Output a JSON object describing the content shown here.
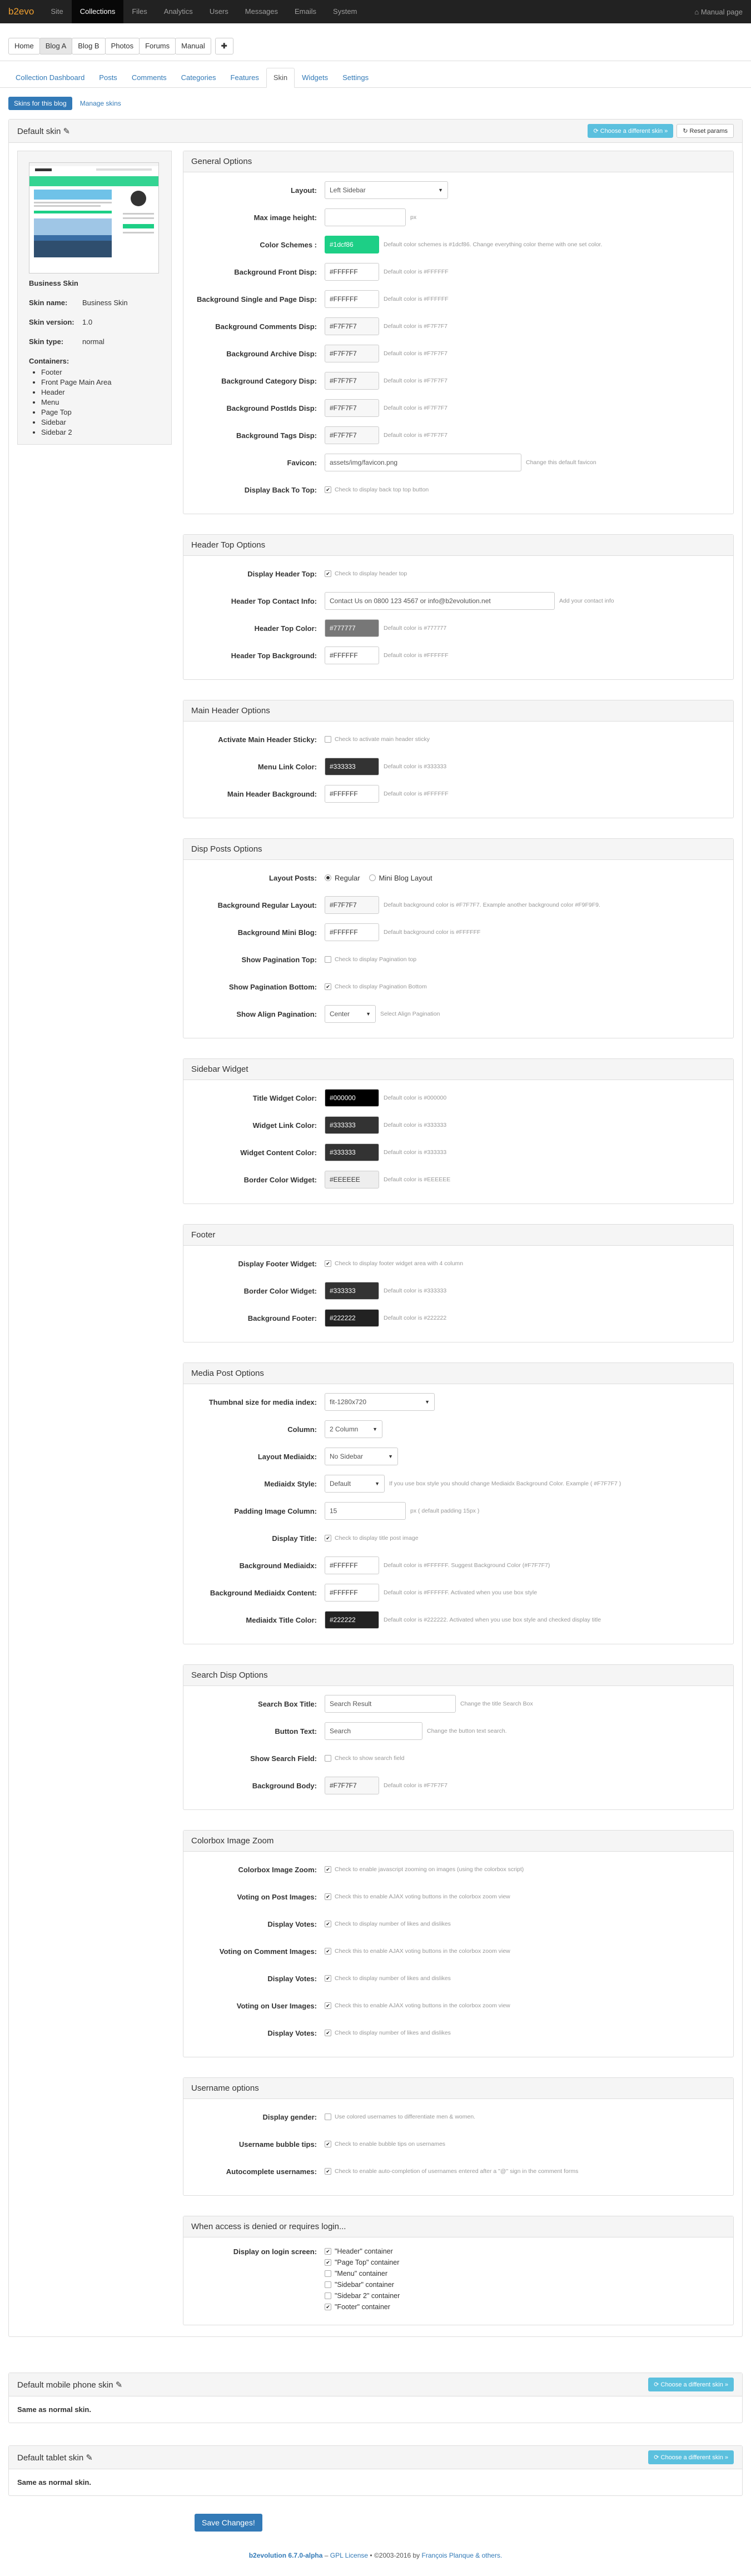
{
  "topbar": {
    "brand": "b2evo",
    "items": [
      "Site",
      "Collections",
      "Files",
      "Analytics",
      "Users",
      "Messages",
      "Emails",
      "System"
    ],
    "active": "Collections",
    "right_icon": "home-icon",
    "right_label": "Manual page"
  },
  "collections": {
    "tabs": [
      "Home",
      "Blog A",
      "Blog B",
      "Photos",
      "Forums",
      "Manual"
    ],
    "active": "Blog A",
    "add_label": "✚"
  },
  "subtabs": {
    "items": [
      "Collection Dashboard",
      "Posts",
      "Comments",
      "Categories",
      "Features",
      "Skin",
      "Widgets",
      "Settings"
    ],
    "active": "Skin"
  },
  "skin_nav": {
    "primary": "Skins for this blog",
    "link": "Manage skins"
  },
  "default_skin": {
    "title": "Default skin",
    "choose_label": "Choose a different skin »",
    "reset_label": "Reset params",
    "skin_card": {
      "name_title": "Business Skin",
      "name_key": "Skin name:",
      "name_val": "Business Skin",
      "version_key": "Skin version:",
      "version_val": "1.0",
      "type_key": "Skin type:",
      "type_val": "normal",
      "containers_title": "Containers:",
      "containers": [
        "Footer",
        "Front Page Main Area",
        "Header",
        "Menu",
        "Page Top",
        "Sidebar",
        "Sidebar 2"
      ]
    }
  },
  "general": {
    "legend": "General Options",
    "layout_label": "Layout:",
    "layout_value": "Left Sidebar",
    "maxh_label": "Max image height:",
    "maxh_value": "",
    "maxh_unit": "px",
    "scheme_label": "Color Schemes :",
    "scheme_value": "#1dcf86",
    "scheme_note": "Default color schemes is #1dcf86. Change everything color theme with one set color.",
    "front_label": "Background Front Disp:",
    "front_value": "#FFFFFF",
    "front_note": "Default color is #FFFFFF",
    "single_label": "Background Single and Page Disp:",
    "single_value": "#FFFFFF",
    "single_note": "Default color is #FFFFFF",
    "comments_label": "Background Comments Disp:",
    "comments_value": "#F7F7F7",
    "comments_note": "Default color is #F7F7F7",
    "archive_label": "Background Archive Disp:",
    "archive_value": "#F7F7F7",
    "archive_note": "Default color is #F7F7F7",
    "category_label": "Background Category Disp:",
    "category_value": "#F7F7F7",
    "category_note": "Default color is #F7F7F7",
    "postids_label": "Background PostIds Disp:",
    "postids_value": "#F7F7F7",
    "postids_note": "Default color is #F7F7F7",
    "tags_label": "Background Tags Disp:",
    "tags_value": "#F7F7F7",
    "tags_note": "Default color is #F7F7F7",
    "favicon_label": "Favicon:",
    "favicon_value": "assets/img/favicon.png",
    "favicon_note": "Change this default favicon",
    "backtop_label": "Display Back To Top:",
    "backtop_note": "Check to display back top top button"
  },
  "header_top": {
    "legend": "Header Top Options",
    "display_label": "Display Header Top:",
    "display_note": "Check to display header top",
    "contact_label": "Header Top Contact Info:",
    "contact_value": "Contact Us on 0800 123 4567 or info@b2evolution.net",
    "contact_note": "Add your contact info",
    "color_label": "Header Top Color:",
    "color_value": "#777777",
    "color_note": "Default color is #777777",
    "bg_label": "Header Top Background:",
    "bg_value": "#FFFFFF",
    "bg_note": "Default color is #FFFFFF"
  },
  "main_header": {
    "legend": "Main Header Options",
    "sticky_label": "Activate Main Header Sticky:",
    "sticky_note": "Check to activate main header sticky",
    "menu_label": "Menu Link Color:",
    "menu_value": "#333333",
    "menu_note": "Default color is #333333",
    "bg_label": "Main Header Background:",
    "bg_value": "#FFFFFF",
    "bg_note": "Default color is #FFFFFF"
  },
  "disp_posts": {
    "legend": "Disp Posts Options",
    "layout_label": "Layout Posts:",
    "opt_regular": "Regular",
    "opt_mini": "Mini Blog Layout",
    "reg_label": "Background Regular Layout:",
    "reg_value": "#F7F7F7",
    "reg_note": "Default background color is #F7F7F7. Example another background color #F9F9F9.",
    "mini_label": "Background Mini Blog:",
    "mini_value": "#FFFFFF",
    "mini_note": "Default background color is #FFFFFF",
    "pagtop_label": "Show Pagination Top:",
    "pagtop_note": "Check to display Pagination top",
    "pagbot_label": "Show Pagination Bottom:",
    "pagbot_note": "Check to display Pagination Bottom",
    "align_label": "Show Align Pagination:",
    "align_value": "Center",
    "align_note": "Select Align Pagination"
  },
  "sidebar": {
    "legend": "Sidebar Widget",
    "title_label": "Title Widget Color:",
    "title_value": "#000000",
    "title_note": "Default color is #000000",
    "link_label": "Widget Link Color:",
    "link_value": "#333333",
    "link_note": "Default color is #333333",
    "content_label": "Widget Content Color:",
    "content_value": "#333333",
    "content_note": "Default color is #333333",
    "border_label": "Border Color Widget:",
    "border_value": "#EEEEEE",
    "border_note": "Default color is #EEEEEE"
  },
  "footer_opts": {
    "legend": "Footer",
    "display_label": "Display Footer Widget:",
    "display_note": "Check to display footer widget area with 4 column",
    "border_label": "Border Color Widget:",
    "border_value": "#333333",
    "border_note": "Default color is #333333",
    "bg_label": "Background Footer:",
    "bg_value": "#222222",
    "bg_note": "Default color is #222222"
  },
  "media": {
    "legend": "Media Post Options",
    "thumb_label": "Thumbnal size for media index:",
    "thumb_value": "fit-1280x720",
    "column_label": "Column:",
    "column_value": "2 Column",
    "layout_label": "Layout Mediaidx:",
    "layout_value": "No Sidebar",
    "style_label": "Mediaidx Style:",
    "style_value": "Default",
    "style_note": "If you use box style you should change Mediaidx Background Color. Example ( #F7F7F7 )",
    "padding_label": "Padding Image Column:",
    "padding_value": "15",
    "padding_note": "px ( default padding 15px )",
    "dtitle_label": "Display Title:",
    "dtitle_note": "Check to display title post image",
    "bg_label": "Background Mediaidx:",
    "bg_value": "#FFFFFF",
    "bg_note": "Default color is #FFFFFF. Suggest Background Color (#F7F7F7)",
    "content_label": "Background Mediaidx Content:",
    "content_value": "#FFFFFF",
    "content_note": "Default color is #FFFFFF. Activated when you use box style",
    "tcolor_label": "Mediaidx Title Color:",
    "tcolor_value": "#222222",
    "tcolor_note": "Default color is #222222. Activated when you use box style and checked display title"
  },
  "search": {
    "legend": "Search Disp Options",
    "title_label": "Search Box Title:",
    "title_value": "Search Result",
    "title_note": "Change the title Search Box",
    "btn_label": "Button Text:",
    "btn_value": "Search",
    "btn_note": "Change the button text search.",
    "field_label": "Show Search Field:",
    "field_note": "Check to show search field",
    "bg_label": "Background Body:",
    "bg_value": "#F7F7F7",
    "bg_note": "Default color is #F7F7F7"
  },
  "colorbox": {
    "legend": "Colorbox Image Zoom",
    "zoom_label": "Colorbox Image Zoom:",
    "zoom_note": "Check to enable javascript zooming on images (using the colorbox script)",
    "vpost_label": "Voting on Post Images:",
    "vpost_note": "Check this to enable AJAX voting buttons in the colorbox zoom view",
    "dv1_label": "Display Votes:",
    "dv1_note": "Check to display number of likes and dislikes",
    "vcomm_label": "Voting on Comment Images:",
    "vcomm_note": "Check this to enable AJAX voting buttons in the colorbox zoom view",
    "dv2_label": "Display Votes:",
    "dv2_note": "Check to display number of likes and dislikes",
    "vuser_label": "Voting on User Images:",
    "vuser_note": "Check this to enable AJAX voting buttons in the colorbox zoom view",
    "dv3_label": "Display Votes:",
    "dv3_note": "Check to display number of likes and dislikes"
  },
  "username": {
    "legend": "Username options",
    "gender_label": "Display gender:",
    "gender_note": "Use colored usernames to differentiate men & women.",
    "bubble_label": "Username bubble tips:",
    "bubble_note": "Check to enable bubble tips on usernames",
    "auto_label": "Autocomplete usernames:",
    "auto_note": "Check to enable auto-completion of usernames entered after a \"@\" sign in the comment forms"
  },
  "access": {
    "legend": "When access is denied or requires login...",
    "login_label": "Display on login screen:",
    "containers": [
      {
        "label": "\"Header\" container",
        "checked": true
      },
      {
        "label": "\"Page Top\" container",
        "checked": true
      },
      {
        "label": "\"Menu\" container",
        "checked": false
      },
      {
        "label": "\"Sidebar\" container",
        "checked": false
      },
      {
        "label": "\"Sidebar 2\" container",
        "checked": false
      },
      {
        "label": "\"Footer\" container",
        "checked": true
      }
    ]
  },
  "mobile": {
    "title": "Default mobile phone skin",
    "choose": "Choose a different skin »",
    "body": "Same as normal skin."
  },
  "tablet": {
    "title": "Default tablet skin",
    "choose": "Choose a different skin »",
    "body": "Same as normal skin."
  },
  "save_label": "Save Changes!",
  "footer": {
    "brand": "b2evolution 6.7.0-alpha",
    "license": "GPL License",
    "copy": "©2003-2016 by",
    "author": "François Planque & others."
  },
  "colors": {
    "accent": "#337ab7",
    "scheme": "#1dcf86",
    "info": "#5bc0de",
    "topbar": "#222222"
  }
}
